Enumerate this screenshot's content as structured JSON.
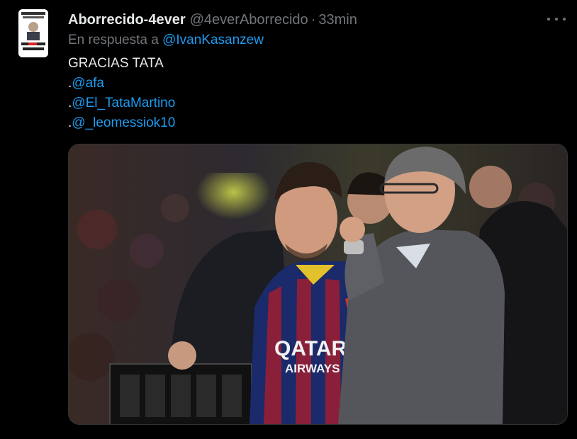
{
  "tweet": {
    "display_name": "Aborrecido-4ever",
    "handle": "@4everAborrecido",
    "separator": "·",
    "time": "33min",
    "more_icon": "more-horizontal-icon",
    "reply_prefix": "En respuesta a",
    "reply_mention": "@IvanKasanzew",
    "lines": [
      {
        "prefix": "",
        "text": "GRACIAS TATA",
        "is_link": false
      },
      {
        "prefix": ".",
        "text": "@afa",
        "is_link": true
      },
      {
        "prefix": ".",
        "text": "@El_TataMartino",
        "is_link": true
      },
      {
        "prefix": ".",
        "text": "@_leomessiok10",
        "is_link": true
      }
    ],
    "media": {
      "jersey_sponsor_line1": "QATAR",
      "jersey_sponsor_line2": "AIRWAYS"
    }
  },
  "colors": {
    "background": "#000000",
    "text": "#e7e9ea",
    "muted": "#71767b",
    "link": "#1d9bf0"
  }
}
